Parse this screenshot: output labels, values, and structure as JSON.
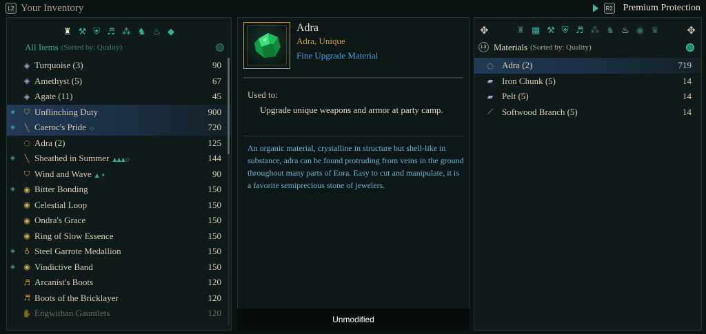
{
  "topbar": {
    "left_button": "L2",
    "left_title": "Your Inventory",
    "right_button": "R2",
    "right_title": "Premium Protection"
  },
  "inventory": {
    "header": "All Items",
    "sort_label": "(Sorted by: Quality)",
    "categories": [
      "bag",
      "tools",
      "armor",
      "boots",
      "gems",
      "helm",
      "lamp",
      "jewel"
    ],
    "items": [
      {
        "name": "Turquoise (3)",
        "value": "90",
        "icon": "gem-icon",
        "glyph": "◈",
        "badge": "",
        "marked": false
      },
      {
        "name": "Amethyst (5)",
        "value": "67",
        "icon": "gem-icon",
        "glyph": "◈",
        "badge": "",
        "marked": false
      },
      {
        "name": "Agate (11)",
        "value": "45",
        "icon": "gem-icon",
        "glyph": "◈",
        "badge": "",
        "marked": false
      },
      {
        "name": "Unflinching Duty",
        "value": "900",
        "icon": "shield-icon",
        "glyph": "⛉",
        "badge": "",
        "marked": true
      },
      {
        "name": "Caeroc's Pride",
        "value": "720",
        "icon": "sword-icon",
        "glyph": "╲",
        "badge": "◇",
        "marked": true
      },
      {
        "name": "Adra (2)",
        "value": "125",
        "icon": "adra-icon",
        "glyph": "◌",
        "badge": "",
        "marked": false
      },
      {
        "name": "Sheathed in Summer",
        "value": "144",
        "icon": "sword-icon",
        "glyph": "╲",
        "badge": "▲▲▲◇",
        "marked": true
      },
      {
        "name": "Wind and Wave",
        "value": "90",
        "icon": "shield-icon",
        "glyph": "⛉",
        "badge": "▲ ✦",
        "marked": false
      },
      {
        "name": "Bitter Bonding",
        "value": "150",
        "icon": "ring-icon",
        "glyph": "◉",
        "badge": "",
        "marked": true
      },
      {
        "name": "Celestial Loop",
        "value": "150",
        "icon": "ring-icon",
        "glyph": "◉",
        "badge": "",
        "marked": false
      },
      {
        "name": "Ondra's Grace",
        "value": "150",
        "icon": "ring-icon",
        "glyph": "◉",
        "badge": "",
        "marked": false
      },
      {
        "name": "Ring of Slow Essence",
        "value": "150",
        "icon": "ring-icon",
        "glyph": "◉",
        "badge": "",
        "marked": false
      },
      {
        "name": "Steel Garrote Medallion",
        "value": "150",
        "icon": "medallion-icon",
        "glyph": "♁",
        "badge": "",
        "marked": true
      },
      {
        "name": "Vindictive Band",
        "value": "150",
        "icon": "ring-icon",
        "glyph": "◉",
        "badge": "",
        "marked": true
      },
      {
        "name": "Arcanist's Boots",
        "value": "120",
        "icon": "boots-icon",
        "glyph": "♬",
        "badge": "",
        "marked": false
      },
      {
        "name": "Boots of the Bricklayer",
        "value": "120",
        "icon": "boots-icon",
        "glyph": "♬",
        "badge": "",
        "marked": false
      },
      {
        "name": "Engwithan Gauntlets",
        "value": "120",
        "icon": "gauntlets-icon",
        "glyph": "✋",
        "badge": "",
        "marked": false
      }
    ]
  },
  "detail": {
    "name": "Adra",
    "subtitle": "Adra, Unique",
    "type": "Fine Upgrade Material",
    "used_label": "Used to:",
    "used_text": "Upgrade unique weapons and armor at party camp.",
    "description": "An organic material, crystalline in structure but shell-like in substance, adra can be found protruding from veins in the ground throughout many parts of Eora. Easy to cut and manipulate, it is a favorite semiprecious stone of jewelers."
  },
  "materials": {
    "l3_button": "L3",
    "header": "Materials",
    "sort_label": "(Sorted by: Quality)",
    "items": [
      {
        "name": "Adra (2)",
        "value": "719",
        "glyph": "◌",
        "icon": "adra-icon"
      },
      {
        "name": "Iron Chunk (5)",
        "value": "14",
        "glyph": "▰",
        "icon": "iron-chunk-icon"
      },
      {
        "name": "Pelt (5)",
        "value": "14",
        "glyph": "▰",
        "icon": "pelt-icon"
      },
      {
        "name": "Softwood Branch (5)",
        "value": "14",
        "glyph": "⟋",
        "icon": "branch-icon"
      }
    ]
  },
  "footer": {
    "label": "Unmodified"
  },
  "colors": {
    "accent": "#2fb59e",
    "gold": "#c9a14f",
    "blue_text": "#4d9fd7",
    "selected_row": "#223a56"
  }
}
